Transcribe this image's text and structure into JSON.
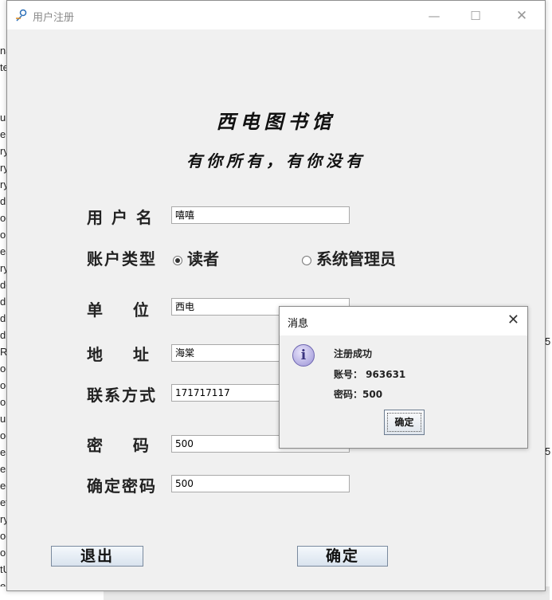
{
  "window": {
    "title": "用户注册",
    "minimize": "—",
    "maximize": "☐",
    "close": "✕"
  },
  "headings": {
    "title": "西电图书馆",
    "slogan": "有你所有，有你没有"
  },
  "form": {
    "username": {
      "label": "用 户 名",
      "value": "嘻嘻"
    },
    "account_type": {
      "label": "账户类型",
      "options": [
        {
          "label": "读者",
          "selected": true
        },
        {
          "label": "系统管理员",
          "selected": false
        }
      ]
    },
    "unit": {
      "label": "单    位",
      "value": "西电"
    },
    "address": {
      "label": "地    址",
      "value": "海棠"
    },
    "contact": {
      "label": "联系方式",
      "value": "171717117"
    },
    "password": {
      "label": "密    码",
      "value": "500"
    },
    "confirm_password": {
      "label": "确定密码",
      "value": "500"
    }
  },
  "buttons": {
    "exit": "退出",
    "confirm": "确定"
  },
  "dialog": {
    "title": "消息",
    "close": "✕",
    "icon": "info-icon",
    "message": "注册成功",
    "account_line": "账号： 963631",
    "password_line": "密码：500",
    "ok": "确定"
  },
  "background_text": {
    "left": [
      "na",
      "te",
      "",
      "",
      "u",
      "e",
      "ry",
      "ry",
      "ry",
      "dr",
      "oc",
      "or",
      "ea",
      "ry",
      "do",
      "dr",
      "dr",
      "dr",
      "Re",
      "oc",
      "oc",
      "or",
      "ur",
      "og",
      "ea",
      "ea",
      "eg",
      "et",
      "ry",
      "oc",
      "ol",
      "tU",
      "eg"
    ],
    "right_a": "5",
    "right_b": "5"
  }
}
